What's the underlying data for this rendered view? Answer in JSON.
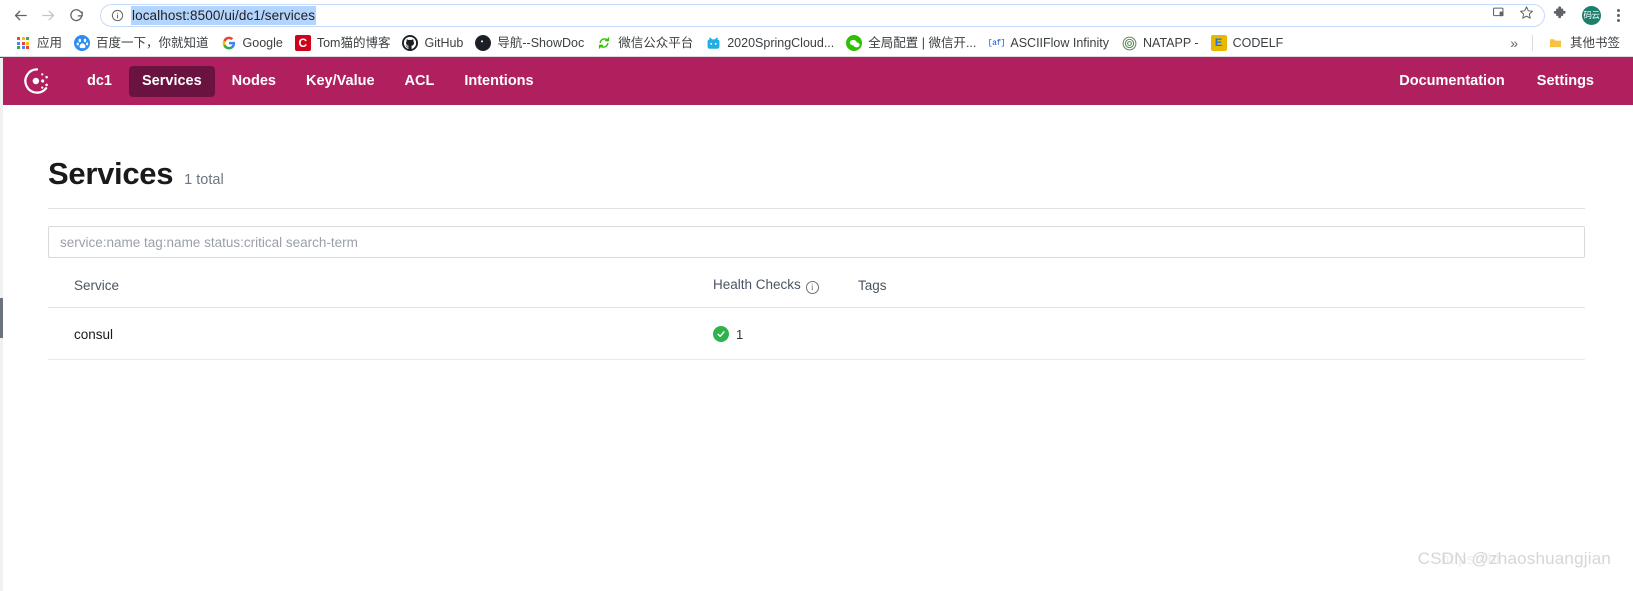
{
  "browser": {
    "back_icon": "back-arrow-icon",
    "forward_icon": "forward-arrow-icon",
    "reload_icon": "reload-icon",
    "site_info_icon": "info-circle-icon",
    "url": "localhost:8500/ui/dc1/services",
    "cast_icon": "cast-icon",
    "bookmark_star_icon": "star-icon",
    "extensions_icon": "puzzle-piece-icon",
    "avatar_label": "码云",
    "menu_icon": "three-dot-menu-icon",
    "bookmarks": [
      {
        "label": "应用",
        "icon": "apps-grid-icon"
      },
      {
        "label": "百度一下，你就知道",
        "icon": "baidu-icon",
        "glyph": "熊"
      },
      {
        "label": "Google",
        "icon": "google-icon",
        "glyph": "G"
      },
      {
        "label": "Tom猫的博客",
        "icon": "tom-blog-icon",
        "glyph": "C"
      },
      {
        "label": "GitHub",
        "icon": "github-icon",
        "glyph": "⌂"
      },
      {
        "label": "导航--ShowDoc",
        "icon": "showdoc-icon",
        "glyph": "◗"
      },
      {
        "label": "微信公众平台",
        "icon": "wechat-mp-icon",
        "glyph": "↻"
      },
      {
        "label": "2020SpringCloud...",
        "icon": "bilibili-icon",
        "glyph": "📺"
      },
      {
        "label": "全局配置 | 微信开...",
        "icon": "wechat-icon",
        "glyph": "💬"
      },
      {
        "label": "ASCIIFlow Infinity",
        "icon": "asciiflow-icon",
        "glyph": "[af]"
      },
      {
        "label": "NATAPP -",
        "icon": "natapp-icon",
        "glyph": "◎"
      },
      {
        "label": "CODELF",
        "icon": "codelf-icon",
        "glyph": "E"
      }
    ],
    "overflow_label": "»",
    "other_bookmarks": {
      "label": "其他书签",
      "icon": "folder-icon"
    }
  },
  "consul_nav": {
    "logo": "consul-logo-icon",
    "datacenter": "dc1",
    "items": [
      {
        "label": "Services",
        "active": true
      },
      {
        "label": "Nodes",
        "active": false
      },
      {
        "label": "Key/Value",
        "active": false
      },
      {
        "label": "ACL",
        "active": false
      },
      {
        "label": "Intentions",
        "active": false
      }
    ],
    "right_items": [
      {
        "label": "Documentation"
      },
      {
        "label": "Settings"
      }
    ],
    "bar_color": "#b0205f",
    "active_color": "#6b1340"
  },
  "page": {
    "title": "Services",
    "total": "1 total",
    "search_placeholder": "service:name tag:name status:critical search-term",
    "search_value": "",
    "table": {
      "headers": {
        "service": "Service",
        "health_checks": "Health Checks",
        "health_checks_info_icon": "info-icon",
        "tags": "Tags"
      },
      "rows": [
        {
          "service": "consul",
          "health_status": "passing",
          "health_color": "#2eb24c",
          "health_count": "1",
          "tags": ""
        }
      ]
    }
  },
  "watermark": {
    "url_text": "https://bl",
    "text": "CSDN @zhaoshuangjian"
  }
}
